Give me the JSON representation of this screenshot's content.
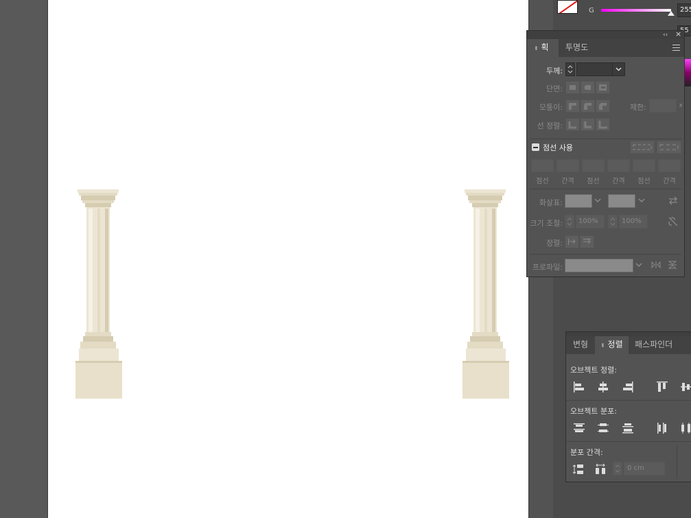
{
  "canvas": {
    "artboard_color": "#ffffff",
    "pasteboard_color": "#595959",
    "objects": [
      "column-left",
      "column-right"
    ]
  },
  "color_panel": {
    "channel_label": "G",
    "channel_value": "255",
    "second_value": "55"
  },
  "stroke_panel": {
    "tabs": [
      {
        "label": "획",
        "active": true
      },
      {
        "label": "투명도",
        "active": false
      }
    ],
    "weight_label": "두께:",
    "weight_value": "",
    "cap_label": "단면:",
    "corner_label": "모퉁이:",
    "limit_label": "제한:",
    "limit_suffix": "x",
    "align_stroke_label": "선 정렬:",
    "dashed_label": "점선 사용",
    "dash_labels": [
      "점선",
      "간격",
      "점선",
      "간격",
      "점선",
      "간격"
    ],
    "arrowheads_label": "화살표:",
    "scale_label": "크기 조절:",
    "scale_start": "100%",
    "scale_end": "100%",
    "align_label": "정렬:",
    "profile_label": "프로파일:"
  },
  "align_panel": {
    "tabs": [
      {
        "label": "변형",
        "active": false
      },
      {
        "label": "정렬",
        "active": true
      },
      {
        "label": "패스파인더",
        "active": false
      }
    ],
    "align_objects_label": "오브젝트 정렬:",
    "distribute_objects_label": "오브젝트 분포:",
    "distribute_spacing_label": "분포 간격:",
    "spacing_value": "0 cm"
  },
  "colors": {
    "column_light": "#ece5d3",
    "column_mid": "#e3dbc4",
    "column_dark": "#d6ccb1",
    "column_shadow": "#c9bea0",
    "panel_bg": "#535353",
    "panel_dark": "#424242",
    "accent_magenta": "#ff00ff"
  }
}
